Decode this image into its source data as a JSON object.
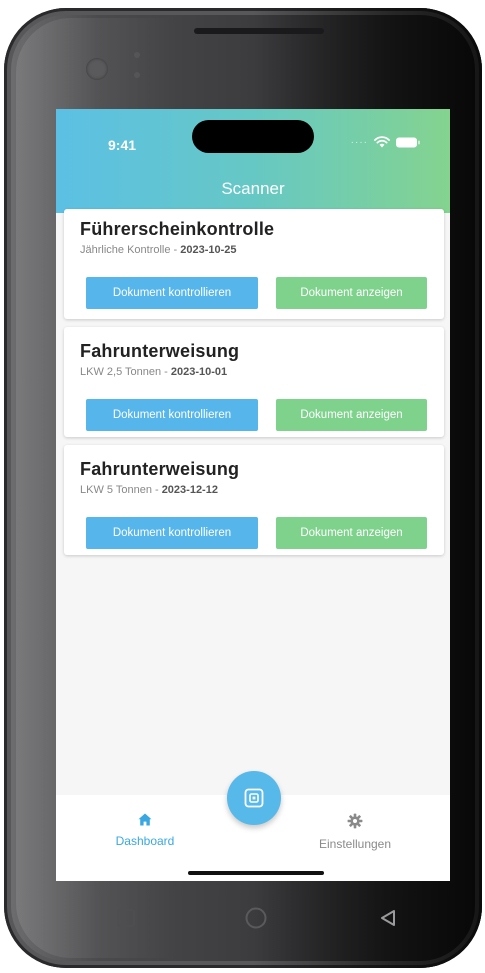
{
  "status_bar": {
    "time": "9:41"
  },
  "header": {
    "title": "Scanner"
  },
  "colors": {
    "header_gradient_start": "#5cc0e5",
    "header_gradient_end": "#84d38f",
    "primary_blue": "#56b5ea",
    "primary_green": "#7ed28c",
    "active_nav": "#3aa8e0"
  },
  "cards": [
    {
      "title": "Führerscheinkontrolle",
      "subtitle": "Jährliche Kontrolle -",
      "date": "2023-10-25",
      "check_label": "Dokument kontrollieren",
      "view_label": "Dokument anzeigen"
    },
    {
      "title": "Fahrunterweisung",
      "subtitle": "LKW 2,5 Tonnen -",
      "date": "2023-10-01",
      "check_label": "Dokument kontrollieren",
      "view_label": "Dokument anzeigen"
    },
    {
      "title": "Fahrunterweisung",
      "subtitle": "LKW 5 Tonnen -",
      "date": "2023-12-12",
      "check_label": "Dokument kontrollieren",
      "view_label": "Dokument anzeigen"
    }
  ],
  "bottom_nav": {
    "items": [
      {
        "label": "Dashboard",
        "icon": "home-icon",
        "active": true
      },
      {
        "label": "Einstellungen",
        "icon": "gear-icon",
        "active": false
      }
    ],
    "fab_icon": "scan-icon"
  },
  "android_nav": {
    "icons": [
      "recents-icon",
      "home-circle-icon",
      "back-triangle-icon"
    ]
  }
}
